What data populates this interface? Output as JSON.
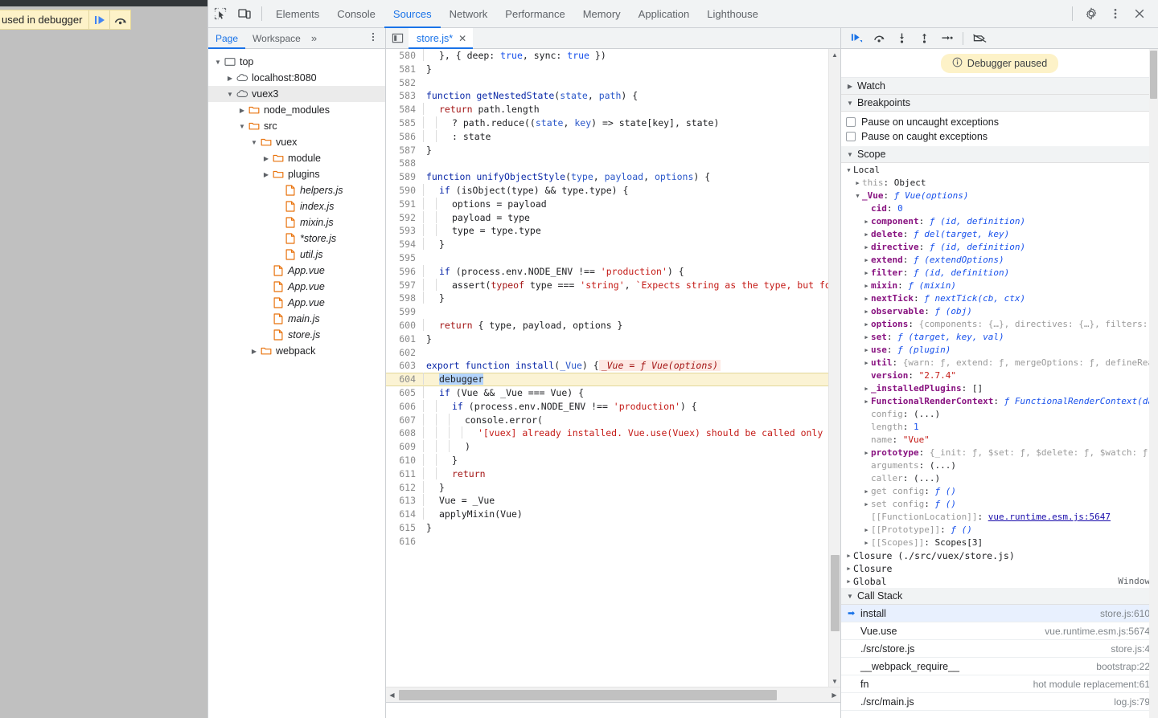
{
  "browser": {
    "paused_text": "used in debugger",
    "resume_icon": "resume-script-icon",
    "step_over_icon": "step-over-icon"
  },
  "toolbar": {
    "inspect_icon": "inspect-element-icon",
    "device_icon": "device-toolbar-icon",
    "tabs": [
      {
        "label": "Elements",
        "active": false
      },
      {
        "label": "Console",
        "active": false
      },
      {
        "label": "Sources",
        "active": true
      },
      {
        "label": "Network",
        "active": false
      },
      {
        "label": "Performance",
        "active": false
      },
      {
        "label": "Memory",
        "active": false
      },
      {
        "label": "Application",
        "active": false
      },
      {
        "label": "Lighthouse",
        "active": false
      }
    ],
    "settings_icon": "gear-icon",
    "kebab_icon": "more-options-icon",
    "close_icon": "close-icon"
  },
  "navigator": {
    "tabs": [
      {
        "label": "Page",
        "active": true
      },
      {
        "label": "Workspace",
        "active": false
      }
    ],
    "more_label": "»",
    "kebab_icon": "more-options-icon",
    "tree": [
      {
        "label": "top",
        "indent": 0,
        "icon": "frame-icon",
        "expanded": true,
        "type": "frame",
        "italic": false,
        "selected": false
      },
      {
        "label": "localhost:8080",
        "indent": 1,
        "icon": "cloud-icon",
        "expanded": false,
        "type": "domain",
        "italic": false,
        "selected": false
      },
      {
        "label": "vuex3",
        "indent": 1,
        "icon": "cloud-icon",
        "expanded": true,
        "type": "domain",
        "italic": false,
        "selected": true
      },
      {
        "label": "node_modules",
        "indent": 2,
        "icon": "folder-icon",
        "expanded": false,
        "type": "folder",
        "italic": false,
        "selected": false
      },
      {
        "label": "src",
        "indent": 2,
        "icon": "folder-icon",
        "expanded": true,
        "type": "folder",
        "italic": false,
        "selected": false
      },
      {
        "label": "vuex",
        "indent": 3,
        "icon": "folder-icon",
        "expanded": true,
        "type": "folder",
        "italic": false,
        "selected": false
      },
      {
        "label": "module",
        "indent": 4,
        "icon": "folder-icon",
        "expanded": false,
        "type": "folder",
        "italic": false,
        "selected": false
      },
      {
        "label": "plugins",
        "indent": 4,
        "icon": "folder-icon",
        "expanded": false,
        "type": "folder",
        "italic": false,
        "selected": false
      },
      {
        "label": "helpers.js",
        "indent": 5,
        "icon": "file-icon",
        "expanded": null,
        "type": "file",
        "italic": true,
        "selected": false
      },
      {
        "label": "index.js",
        "indent": 5,
        "icon": "file-icon",
        "expanded": null,
        "type": "file",
        "italic": true,
        "selected": false
      },
      {
        "label": "mixin.js",
        "indent": 5,
        "icon": "file-icon",
        "expanded": null,
        "type": "file",
        "italic": true,
        "selected": false
      },
      {
        "label": "*store.js",
        "indent": 5,
        "icon": "file-icon",
        "expanded": null,
        "type": "file",
        "italic": true,
        "selected": false
      },
      {
        "label": "util.js",
        "indent": 5,
        "icon": "file-icon",
        "expanded": null,
        "type": "file",
        "italic": true,
        "selected": false
      },
      {
        "label": "App.vue",
        "indent": 4,
        "icon": "file-icon",
        "expanded": null,
        "type": "file",
        "italic": true,
        "selected": false
      },
      {
        "label": "App.vue",
        "indent": 4,
        "icon": "file-icon",
        "expanded": null,
        "type": "file",
        "italic": true,
        "selected": false
      },
      {
        "label": "App.vue",
        "indent": 4,
        "icon": "file-icon",
        "expanded": null,
        "type": "file",
        "italic": true,
        "selected": false
      },
      {
        "label": "main.js",
        "indent": 4,
        "icon": "file-icon",
        "expanded": null,
        "type": "file",
        "italic": true,
        "selected": false
      },
      {
        "label": "store.js",
        "indent": 4,
        "icon": "file-icon",
        "expanded": null,
        "type": "file",
        "italic": true,
        "selected": false
      },
      {
        "label": "webpack",
        "indent": 3,
        "icon": "folder-icon",
        "expanded": false,
        "type": "folder",
        "italic": false,
        "selected": false
      }
    ]
  },
  "editor": {
    "sidebar_toggle_icon": "show-navigator-icon",
    "tab_label": "store.js*",
    "tab_close_icon": "close-icon",
    "first_line": 580,
    "highlighted_line": 604,
    "inline_eval": "_Vue = ƒ Vue(options)",
    "lines": [
      {
        "n": 580,
        "indent": 1,
        "text": "}, { deep: true, sync: true })"
      },
      {
        "n": 581,
        "indent": 0,
        "text": "}"
      },
      {
        "n": 582,
        "indent": 0,
        "text": ""
      },
      {
        "n": 583,
        "indent": 0,
        "text": "function getNestedState(state, path) {"
      },
      {
        "n": 584,
        "indent": 1,
        "text": "return path.length"
      },
      {
        "n": 585,
        "indent": 2,
        "text": "? path.reduce((state, key) => state[key], state)"
      },
      {
        "n": 586,
        "indent": 2,
        "text": ": state"
      },
      {
        "n": 587,
        "indent": 0,
        "text": "}"
      },
      {
        "n": 588,
        "indent": 0,
        "text": ""
      },
      {
        "n": 589,
        "indent": 0,
        "text": "function unifyObjectStyle(type, payload, options) {"
      },
      {
        "n": 590,
        "indent": 1,
        "text": "if (isObject(type) && type.type) {"
      },
      {
        "n": 591,
        "indent": 2,
        "text": "options = payload"
      },
      {
        "n": 592,
        "indent": 2,
        "text": "payload = type"
      },
      {
        "n": 593,
        "indent": 2,
        "text": "type = type.type"
      },
      {
        "n": 594,
        "indent": 1,
        "text": "}"
      },
      {
        "n": 595,
        "indent": 0,
        "text": ""
      },
      {
        "n": 596,
        "indent": 1,
        "text": "if (process.env.NODE_ENV !== 'production') {"
      },
      {
        "n": 597,
        "indent": 2,
        "text": "assert(typeof type === 'string', `Expects string as the type, but found ${type"
      },
      {
        "n": 598,
        "indent": 1,
        "text": "}"
      },
      {
        "n": 599,
        "indent": 0,
        "text": ""
      },
      {
        "n": 600,
        "indent": 1,
        "text": "return { type, payload, options }"
      },
      {
        "n": 601,
        "indent": 0,
        "text": "}"
      },
      {
        "n": 602,
        "indent": 0,
        "text": ""
      },
      {
        "n": 603,
        "indent": 0,
        "text": "export function install(_Vue) {"
      },
      {
        "n": 604,
        "indent": 1,
        "text": "debugger"
      },
      {
        "n": 605,
        "indent": 1,
        "text": "if (Vue && _Vue === Vue) {"
      },
      {
        "n": 606,
        "indent": 2,
        "text": "if (process.env.NODE_ENV !== 'production') {"
      },
      {
        "n": 607,
        "indent": 3,
        "text": "console.error("
      },
      {
        "n": 608,
        "indent": 4,
        "text": "'[vuex] already installed. Vue.use(Vuex) should be called only once.'"
      },
      {
        "n": 609,
        "indent": 3,
        "text": ")"
      },
      {
        "n": 610,
        "indent": 2,
        "text": "}"
      },
      {
        "n": 611,
        "indent": 2,
        "text": "return"
      },
      {
        "n": 612,
        "indent": 1,
        "text": "}"
      },
      {
        "n": 613,
        "indent": 1,
        "text": "Vue = _Vue"
      },
      {
        "n": 614,
        "indent": 1,
        "text": "applyMixin(Vue)"
      },
      {
        "n": 615,
        "indent": 0,
        "text": "}"
      },
      {
        "n": 616,
        "indent": 0,
        "text": ""
      }
    ]
  },
  "debugger": {
    "toolbar_icons": [
      "resume-script-icon",
      "step-over-icon",
      "step-into-icon",
      "step-out-icon",
      "step-icon",
      "deactivate-breakpoints-icon"
    ],
    "paused_banner": "Debugger paused",
    "paused_banner_icon": "info-icon",
    "sections": {
      "watch": "Watch",
      "breakpoints": "Breakpoints",
      "scope": "Scope",
      "call_stack": "Call Stack"
    },
    "breakpoint_options": [
      {
        "label": "Pause on uncaught exceptions",
        "checked": false
      },
      {
        "label": "Pause on caught exceptions",
        "checked": false
      }
    ],
    "scope": [
      {
        "indent": 0,
        "caret": "down",
        "name": "Local",
        "sep": "",
        "value": "",
        "style": "group"
      },
      {
        "indent": 1,
        "caret": "right",
        "name": "this",
        "sep": ": ",
        "value": "Object",
        "style": "dim-name"
      },
      {
        "indent": 1,
        "caret": "down",
        "name": "_Vue",
        "sep": ": ",
        "value": "ƒ Vue(options)",
        "style": "own-fn"
      },
      {
        "indent": 2,
        "caret": "none",
        "name": "cid",
        "sep": ": ",
        "value": "0",
        "style": "own-num"
      },
      {
        "indent": 2,
        "caret": "right",
        "name": "component",
        "sep": ": ",
        "value": "ƒ (id, definition)",
        "style": "own-fn"
      },
      {
        "indent": 2,
        "caret": "right",
        "name": "delete",
        "sep": ": ",
        "value": "ƒ del(target, key)",
        "style": "own-fn"
      },
      {
        "indent": 2,
        "caret": "right",
        "name": "directive",
        "sep": ": ",
        "value": "ƒ (id, definition)",
        "style": "own-fn"
      },
      {
        "indent": 2,
        "caret": "right",
        "name": "extend",
        "sep": ": ",
        "value": "ƒ (extendOptions)",
        "style": "own-fn"
      },
      {
        "indent": 2,
        "caret": "right",
        "name": "filter",
        "sep": ": ",
        "value": "ƒ (id, definition)",
        "style": "own-fn"
      },
      {
        "indent": 2,
        "caret": "right",
        "name": "mixin",
        "sep": ": ",
        "value": "ƒ (mixin)",
        "style": "own-fn"
      },
      {
        "indent": 2,
        "caret": "right",
        "name": "nextTick",
        "sep": ": ",
        "value": "ƒ nextTick(cb, ctx)",
        "style": "own-fn"
      },
      {
        "indent": 2,
        "caret": "right",
        "name": "observable",
        "sep": ": ",
        "value": "ƒ (obj)",
        "style": "own-fn"
      },
      {
        "indent": 2,
        "caret": "right",
        "name": "options",
        "sep": ": ",
        "value": "{components: {…}, directives: {…}, filters:",
        "style": "own-dim"
      },
      {
        "indent": 2,
        "caret": "right",
        "name": "set",
        "sep": ": ",
        "value": "ƒ (target, key, val)",
        "style": "own-fn"
      },
      {
        "indent": 2,
        "caret": "right",
        "name": "use",
        "sep": ": ",
        "value": "ƒ (plugin)",
        "style": "own-fn"
      },
      {
        "indent": 2,
        "caret": "right",
        "name": "util",
        "sep": ": ",
        "value": "{warn: ƒ, extend: ƒ, mergeOptions: ƒ, defineReacti",
        "style": "own-dim"
      },
      {
        "indent": 2,
        "caret": "none",
        "name": "version",
        "sep": ": ",
        "value": "\"2.7.4\"",
        "style": "own-str"
      },
      {
        "indent": 2,
        "caret": "right",
        "name": "_installedPlugins",
        "sep": ": ",
        "value": "[]",
        "style": "own-plain"
      },
      {
        "indent": 2,
        "caret": "right",
        "name": "FunctionalRenderContext",
        "sep": ": ",
        "value": "ƒ FunctionalRenderContext(da",
        "style": "own-fn"
      },
      {
        "indent": 2,
        "caret": "none",
        "name": "config",
        "sep": ": ",
        "value": "(...)",
        "style": "dim-name"
      },
      {
        "indent": 2,
        "caret": "none",
        "name": "length",
        "sep": ": ",
        "value": "1",
        "style": "dim-num"
      },
      {
        "indent": 2,
        "caret": "none",
        "name": "name",
        "sep": ": ",
        "value": "\"Vue\"",
        "style": "dim-str"
      },
      {
        "indent": 2,
        "caret": "right",
        "name": "prototype",
        "sep": ": ",
        "value": "{_init: ƒ, $set: ƒ, $delete: ƒ, $watch: ƒ, $",
        "style": "own-dim"
      },
      {
        "indent": 2,
        "caret": "none",
        "name": "arguments",
        "sep": ": ",
        "value": "(...)",
        "style": "dim-name"
      },
      {
        "indent": 2,
        "caret": "right",
        "name": "get config",
        "sep": ": ",
        "value": "ƒ ()",
        "style": "dim-fn"
      },
      {
        "indent": 2,
        "caret": "right",
        "name": "set config",
        "sep": ": ",
        "value": "ƒ ()",
        "style": "dim-fn"
      },
      {
        "indent": 2,
        "caret": "none",
        "name": "[[FunctionLocation]]",
        "sep": ": ",
        "value": "vue.runtime.esm.js:5647",
        "style": "link"
      },
      {
        "indent": 2,
        "caret": "right",
        "name": "[[Prototype]]",
        "sep": ": ",
        "value": "ƒ ()",
        "style": "dim-fn"
      },
      {
        "indent": 2,
        "caret": "right",
        "name": "[[Scopes]]",
        "sep": ": ",
        "value": "Scopes[3]",
        "style": "dim-plain"
      }
    ],
    "scope_caller_row": {
      "indent": 2,
      "name": "caller",
      "sep": ": ",
      "value": "(...)"
    },
    "scope_groups": [
      {
        "label": "Closure (./src/vuex/store.js)",
        "right": ""
      },
      {
        "label": "Closure",
        "right": ""
      },
      {
        "label": "Global",
        "right": "Window"
      }
    ],
    "call_stack": [
      {
        "fn": "install",
        "loc": "store.js:610",
        "active": true
      },
      {
        "fn": "Vue.use",
        "loc": "vue.runtime.esm.js:5674",
        "active": false
      },
      {
        "fn": "./src/store.js",
        "loc": "store.js:4",
        "active": false
      },
      {
        "fn": "__webpack_require__",
        "loc": "bootstrap:22",
        "active": false
      },
      {
        "fn": "fn",
        "loc": "hot module replacement:61",
        "active": false
      },
      {
        "fn": "./src/main.js",
        "loc": "log.js:79",
        "active": false
      }
    ]
  },
  "colors": {
    "accent": "#1a73e8",
    "paused_yellow": "#fdf2c8",
    "highlight_line": "#fbf3d4",
    "folder_orange": "#e8710a",
    "string_red": "#c41a16",
    "keyword_blue": "#0b29a8",
    "property_purple": "#881280"
  }
}
